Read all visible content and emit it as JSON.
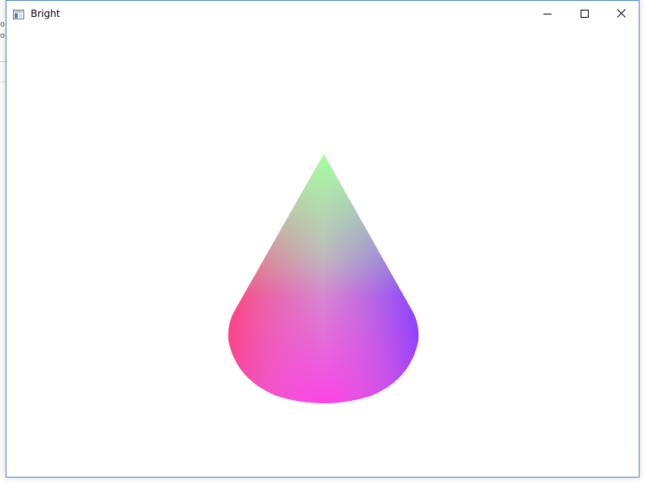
{
  "window": {
    "title": "Bright",
    "accent_border": "#4a8ad0"
  },
  "titlebar": {
    "app_icon": "app-window-icon",
    "controls": {
      "minimize_icon": "minimize-icon",
      "maximize_icon": "maximize-icon",
      "close_icon": "close-icon"
    }
  },
  "background_window": {
    "glyphs": [
      "o",
      "o"
    ]
  },
  "scene": {
    "object": "cone",
    "colors": {
      "apex": "#a6ffa0",
      "left": "#ff3f80",
      "right": "#8a3cff",
      "front": "#ff3ce8",
      "center": "#c8a0c8"
    }
  }
}
